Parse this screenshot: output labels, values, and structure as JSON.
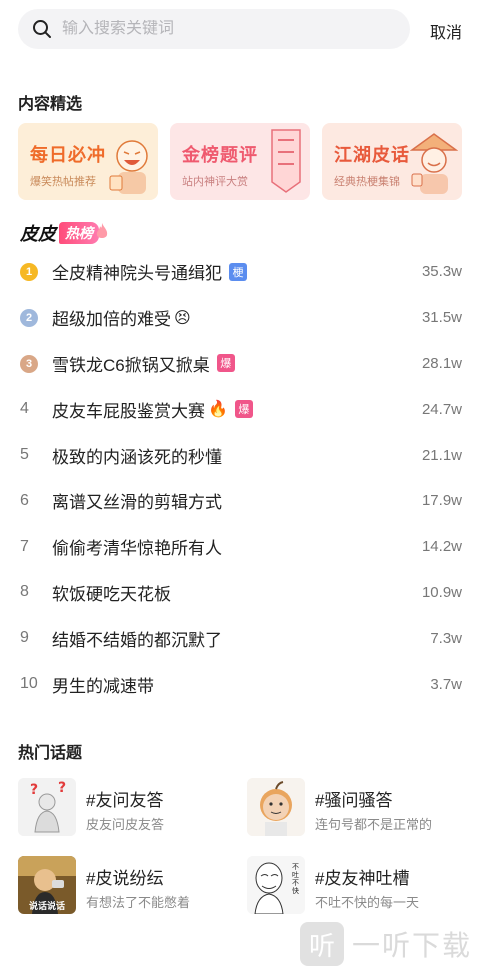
{
  "search": {
    "placeholder": "输入搜索关键词",
    "cancel_label": "取消"
  },
  "featured": {
    "title": "内容精选",
    "cards": [
      {
        "title": "每日必冲",
        "subtitle": "爆笑热帖推荐",
        "bg": "#fdeed8",
        "title_color": "#ef6b2a",
        "sub_color": "#c98a5a"
      },
      {
        "title": "金榜题评",
        "subtitle": "站内神评大赏",
        "bg": "#fde6e6",
        "title_color": "#ef5a6f",
        "sub_color": "#c98080"
      },
      {
        "title": "江湖皮话",
        "subtitle": "经典热梗集锦",
        "bg": "#fde9e1",
        "title_color": "#e85a3c",
        "sub_color": "#c98070"
      }
    ]
  },
  "hotlist": {
    "brand": "皮皮",
    "tag": "热榜",
    "items": [
      {
        "rank": "1",
        "title": "全皮精神院头号通缉犯",
        "badge": "梗",
        "badge_color": "#5b8def",
        "emoji": "",
        "heat": "35.3w",
        "medal": "#f6b824"
      },
      {
        "rank": "2",
        "title": "超级加倍的难受",
        "badge": "",
        "badge_color": "",
        "emoji": "😣",
        "heat": "31.5w",
        "medal": "#9fb8dc"
      },
      {
        "rank": "3",
        "title": "雪铁龙C6掀锅又掀桌",
        "badge": "爆",
        "badge_color": "#f0568a",
        "emoji": "",
        "heat": "28.1w",
        "medal": "#d9a787"
      },
      {
        "rank": "4",
        "title": "皮友车屁股鉴赏大赛",
        "badge": "爆",
        "badge_color": "#f0568a",
        "emoji": "🔥",
        "heat": "24.7w",
        "medal": ""
      },
      {
        "rank": "5",
        "title": "极致的内涵该死的秒懂",
        "badge": "",
        "badge_color": "",
        "emoji": "",
        "heat": "21.1w",
        "medal": ""
      },
      {
        "rank": "6",
        "title": "离谱又丝滑的剪辑方式",
        "badge": "",
        "badge_color": "",
        "emoji": "",
        "heat": "17.9w",
        "medal": ""
      },
      {
        "rank": "7",
        "title": "偷偷考清华惊艳所有人",
        "badge": "",
        "badge_color": "",
        "emoji": "",
        "heat": "14.2w",
        "medal": ""
      },
      {
        "rank": "8",
        "title": "软饭硬吃天花板",
        "badge": "",
        "badge_color": "",
        "emoji": "",
        "heat": "10.9w",
        "medal": ""
      },
      {
        "rank": "9",
        "title": "结婚不结婚的都沉默了",
        "badge": "",
        "badge_color": "",
        "emoji": "",
        "heat": "7.3w",
        "medal": ""
      },
      {
        "rank": "10",
        "title": "男生的减速带",
        "badge": "",
        "badge_color": "",
        "emoji": "",
        "heat": "3.7w",
        "medal": ""
      }
    ]
  },
  "topics": {
    "title": "热门话题",
    "items": [
      {
        "title": "#友问友答",
        "subtitle": "皮友问皮友答",
        "thumb": "question-figure"
      },
      {
        "title": "#骚问骚答",
        "subtitle": "连句号都不是正常的",
        "thumb": "apple-face"
      },
      {
        "title": "#皮说纷纭",
        "subtitle": "有想法了不能憋着",
        "thumb": "speaker-man",
        "thumb_caption": "说话说话"
      },
      {
        "title": "#皮友神吐槽",
        "subtitle": "不吐不快的每一天",
        "thumb": "meme-face",
        "thumb_caption": "不吐不快"
      }
    ]
  },
  "watermark": {
    "logo": "听",
    "text": "一听下载"
  }
}
